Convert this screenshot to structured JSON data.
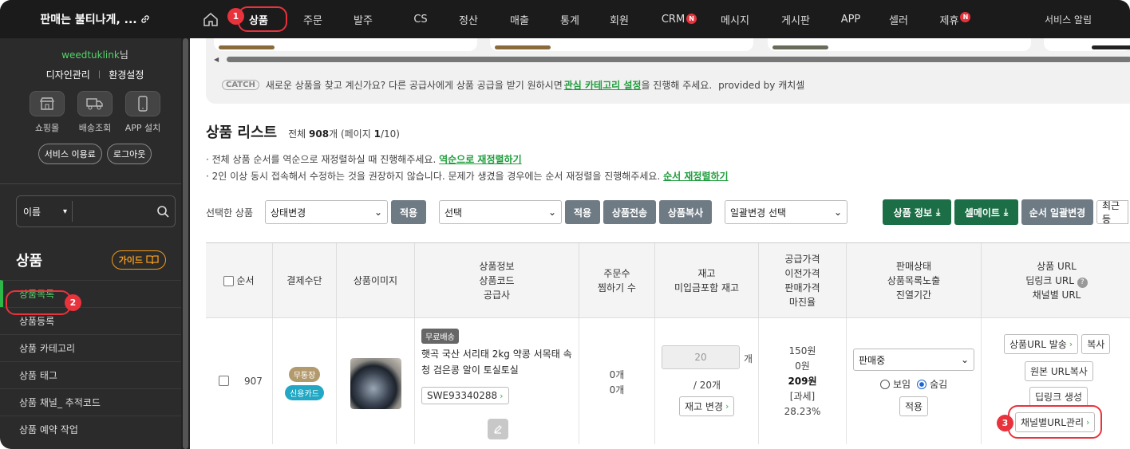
{
  "sidebar": {
    "shop_title": "판매는 불티나게, ...",
    "user": {
      "id": "weedtuklink",
      "suffix": "님"
    },
    "links": [
      "디자인관리",
      "환경설정"
    ],
    "icons": [
      {
        "label": "쇼핑몰",
        "icon": "store-icon"
      },
      {
        "label": "배송조회",
        "icon": "truck-icon"
      },
      {
        "label": "APP 설치",
        "icon": "phone-icon"
      }
    ],
    "buttons": [
      "서비스 이용료",
      "로그아웃"
    ],
    "search": {
      "select": "이름"
    },
    "section_title": "상품",
    "guide_label": "가이드",
    "menu": [
      "상품목록",
      "상품등록",
      "상품 카테고리",
      "상품 태그",
      "상품 채널_ 추적코드",
      "상품 예약 작업"
    ]
  },
  "topnav": {
    "items": [
      "상품",
      "주문",
      "발주",
      "CS",
      "정산",
      "매출",
      "통계",
      "회원",
      "CRM",
      "메시지",
      "게시판",
      "APP",
      "셀러",
      "제휴"
    ],
    "badge": "N",
    "right": "서비스 알림"
  },
  "banner": {
    "logo": "CATCH",
    "text_before": "새로운 상품을 찾고 계신가요? 다른 공급사에게 상품 공급을 받기 원하시면",
    "link": "관심 카테고리 설정",
    "text_after": "을 진행해 주세요.",
    "provided": "provided by 캐치셀"
  },
  "list": {
    "title": "상품 리스트",
    "count_prefix": "전체",
    "count": "908",
    "count_unit": "개",
    "page_info_a": "(페이지",
    "page": "1",
    "page_info_b": "/10)",
    "note1": "· 전체 상품 순서를 역순으로 재정렬하실 때 진행해주세요.",
    "note1_link": "역순으로 재정렬하기",
    "note2": "· 2인 이상 동시 접속해서 수정하는 것을 권장하지 않습니다. 문제가 생겼을 경우에는 순서 재정렬을 진행해주세요.",
    "note2_link": "순서 재정렬하기"
  },
  "toolbar": {
    "selected_label": "선택한 상품",
    "status_select": "상태변경",
    "apply": "적용",
    "select2": "선택",
    "apply2": "적용",
    "transfer": "상품전송",
    "copy": "상품복사",
    "bulk_select": "일괄변경 선택",
    "product_info": "상품 정보",
    "sellmate": "셀메이트",
    "bulk_order": "순서 일괄변경",
    "recent": "최근 등"
  },
  "table": {
    "headers": {
      "order": "순서",
      "payment": "결제수단",
      "image": "상품이미지",
      "info": [
        "상품정보",
        "상품코드",
        "공급사"
      ],
      "orders": [
        "주문수",
        "찜하기 수"
      ],
      "stock": [
        "재고",
        "미입금포함 재고"
      ],
      "price": [
        "공급가격",
        "이전가격",
        "판매가격",
        "마진율"
      ],
      "status": [
        "판매상태",
        "상품목록노출",
        "진열기간"
      ],
      "url": [
        "상품 URL",
        "딥링크 URL",
        "채널별 URL"
      ]
    },
    "row": {
      "num": "907",
      "payments": [
        "무통장",
        "신용카드"
      ],
      "free_ship": "무료배송",
      "name": "햇곡 국산 서리태 2kg 약콩 서목태 속청 검은콩 알이 토실토실",
      "code": "SWE93340288",
      "orders": "0개",
      "wish": "0개",
      "stock": "20",
      "stock_unit": "개",
      "stock_total": "/ 20개",
      "stock_btn": "재고 변경",
      "supply": "150원",
      "prev": "0원",
      "sale": "209원",
      "tax": "[과세]",
      "margin": "28.23%",
      "status": "판매중",
      "show": "보임",
      "hide": "숨김",
      "apply": "적용",
      "url_btn": "상품URL 발송",
      "copy": "복사",
      "orig_url": "원본 URL복사",
      "deeplink": "딥링크 생성",
      "channel_url": "채널별URL관리"
    }
  },
  "markers": [
    "1",
    "2",
    "3"
  ],
  "colors": {
    "accent_green": "#2fb84a",
    "button_green": "#1b6e45",
    "marker_red": "#e8323c",
    "guide_orange": "#f29a1b"
  }
}
